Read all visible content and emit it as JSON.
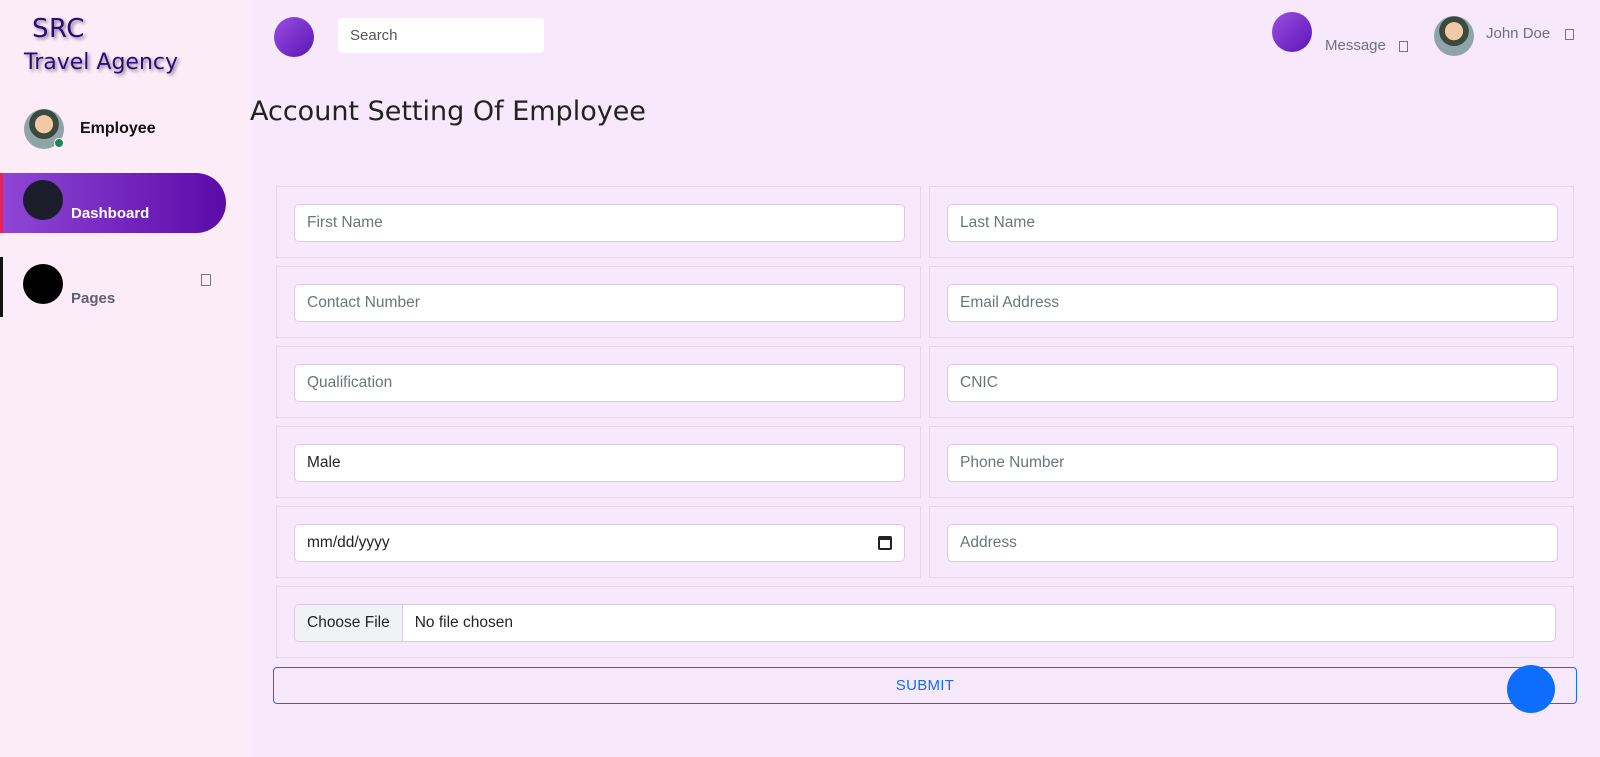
{
  "brand": {
    "line1": "SRC",
    "line2": "Travel Agency"
  },
  "sidebar": {
    "profile_name": "Employee",
    "items": [
      {
        "label": "Dashboard",
        "active": true
      },
      {
        "label": "Pages",
        "active": false
      }
    ]
  },
  "topbar": {
    "search_placeholder": "Search",
    "message_label": "Message",
    "user_name": "John Doe"
  },
  "page": {
    "title": "Account Setting Of Employee"
  },
  "form": {
    "first_name_placeholder": "First Name",
    "last_name_placeholder": "Last Name",
    "contact_number_placeholder": "Contact Number",
    "email_placeholder": "Email Address",
    "qualification_placeholder": "Qualification",
    "cnic_placeholder": "CNIC",
    "gender_value": "Male",
    "phone_number_placeholder": "Phone Number",
    "date_placeholder": "mm/dd/yyyy",
    "address_placeholder": "Address",
    "file_button": "Choose File",
    "file_status": "No file chosen",
    "submit_label": "SUBMIT"
  },
  "colors": {
    "background": "#f8e8fb",
    "sidebar_active_gradient_start": "#8f46d6",
    "sidebar_active_gradient_end": "#5b0aa8",
    "brand_text": "#2b0a7e",
    "primary": "#0d6efd"
  }
}
